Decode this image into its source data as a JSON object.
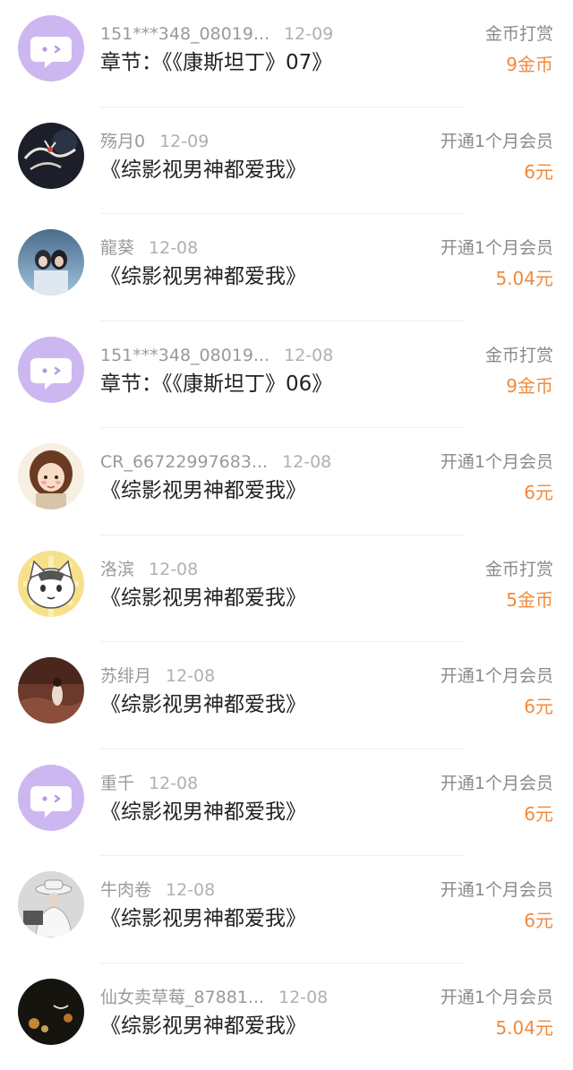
{
  "accent_color": "#f08a3c",
  "items": [
    {
      "name": "151***348_08019...",
      "date": "12-09",
      "title": "章节：《《康斯坦丁》07》",
      "action": "金币打赏",
      "amount": "9金币",
      "avatar": "default-avatar"
    },
    {
      "name": "殇月0",
      "date": "12-09",
      "title": "《综影视男神都爱我》",
      "action": "开通1个月会员",
      "amount": "6元",
      "avatar": "cranes-photo-avatar"
    },
    {
      "name": "龍葵",
      "date": "12-08",
      "title": "《综影视男神都爱我》",
      "action": "开通1个月会员",
      "amount": "5.04元",
      "avatar": "couple-photo-avatar"
    },
    {
      "name": "151***348_08019...",
      "date": "12-08",
      "title": "章节：《《康斯坦丁》06》",
      "action": "金币打赏",
      "amount": "9金币",
      "avatar": "default-avatar"
    },
    {
      "name": "CR_66722997683...",
      "date": "12-08",
      "title": "《综影视男神都爱我》",
      "action": "开通1个月会员",
      "amount": "6元",
      "avatar": "cartoon-girl-avatar"
    },
    {
      "name": "洛滨",
      "date": "12-08",
      "title": "《综影视男神都爱我》",
      "action": "金币打赏",
      "amount": "5金币",
      "avatar": "cartoon-cat-avatar"
    },
    {
      "name": "苏绯月",
      "date": "12-08",
      "title": "《综影视男神都爱我》",
      "action": "开通1个月会员",
      "amount": "6元",
      "avatar": "painting-avatar"
    },
    {
      "name": "重千",
      "date": "12-08",
      "title": "《综影视男神都爱我》",
      "action": "开通1个月会员",
      "amount": "6元",
      "avatar": "default-avatar"
    },
    {
      "name": "牛肉卷",
      "date": "12-08",
      "title": "《综影视男神都爱我》",
      "action": "开通1个月会员",
      "amount": "6元",
      "avatar": "hat-person-avatar"
    },
    {
      "name": "仙女卖草莓_87881...",
      "date": "12-08",
      "title": "《综影视男神都爱我》",
      "action": "开通1个月会员",
      "amount": "5.04元",
      "avatar": "dark-photo-avatar"
    }
  ]
}
